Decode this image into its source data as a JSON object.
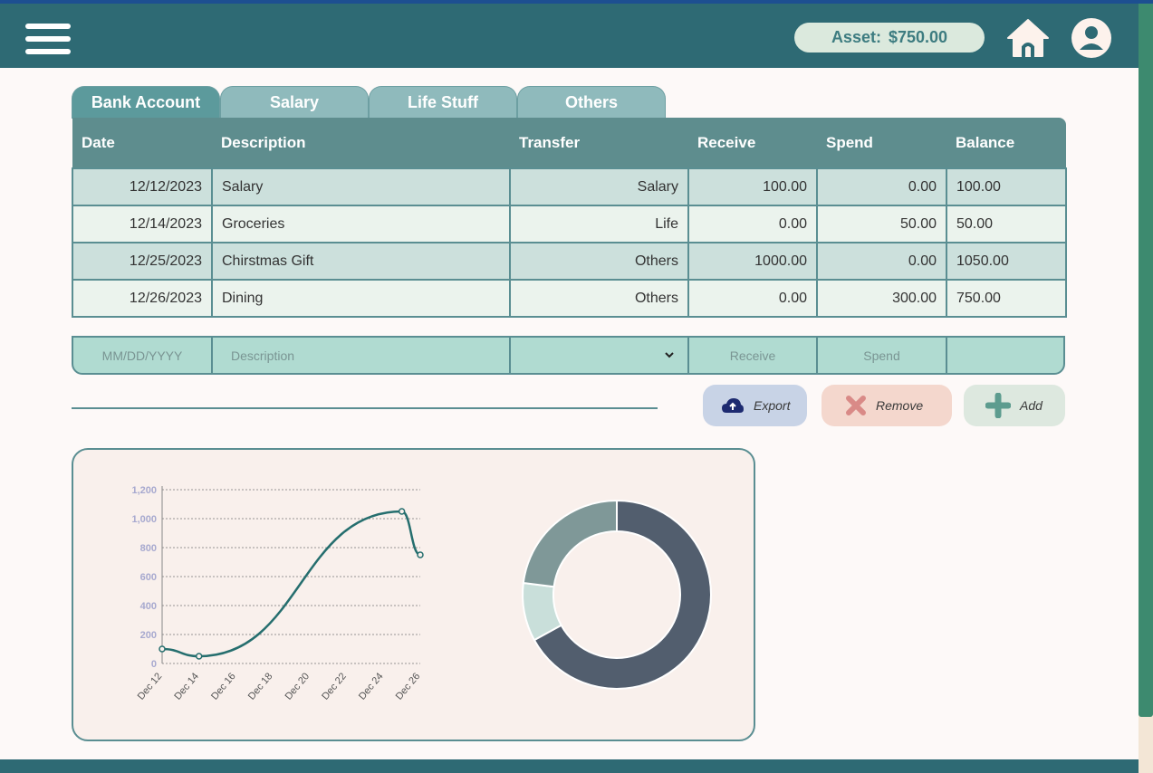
{
  "header": {
    "asset_label": "Asset:",
    "asset_value": "$750.00",
    "menu_icon": "hamburger-menu-icon",
    "home_icon": "home-icon",
    "profile_icon": "user-profile-icon"
  },
  "tabs": [
    {
      "label": "Bank Account",
      "active": true
    },
    {
      "label": "Salary",
      "active": false
    },
    {
      "label": "Life Stuff",
      "active": false
    },
    {
      "label": "Others",
      "active": false
    }
  ],
  "table": {
    "columns": [
      "Date",
      "Description",
      "Transfer",
      "Receive",
      "Spend",
      "Balance"
    ],
    "rows": [
      [
        "12/12/2023",
        "Salary",
        "Salary",
        "100.00",
        "0.00",
        "100.00"
      ],
      [
        "12/14/2023",
        "Groceries",
        "Life",
        "0.00",
        "50.00",
        "50.00"
      ],
      [
        "12/25/2023",
        "Chirstmas Gift",
        "Others",
        "1000.00",
        "0.00",
        "1050.00"
      ],
      [
        "12/26/2023",
        "Dining",
        "Others",
        "0.00",
        "300.00",
        "750.00"
      ]
    ]
  },
  "input_row": {
    "date_placeholder": "MM/DD/YYYY",
    "description_placeholder": "Description",
    "transfer_value": "",
    "receive_placeholder": "Receive",
    "spend_placeholder": "Spend"
  },
  "actions": {
    "export_label": "Export",
    "remove_label": "Remove",
    "add_label": "Add"
  },
  "colors": {
    "header": "#2e6a74",
    "accent": "#5e8d8e",
    "line": "#256e6e"
  },
  "chart_data": [
    {
      "type": "line",
      "x": [
        "Dec 12",
        "Dec 14",
        "Dec 25",
        "Dec 26"
      ],
      "values": [
        100,
        50,
        1050,
        750
      ],
      "x_tick_labels": [
        "Dec 12",
        "Dec 14",
        "Dec 16",
        "Dec 18",
        "Dec 20",
        "Dec 22",
        "Dec 24",
        "Dec 26"
      ],
      "y_tick_labels": [
        "0",
        "200",
        "400",
        "600",
        "800",
        "1,000",
        "1,200"
      ],
      "ylim": [
        0,
        1200
      ],
      "grid": true
    },
    {
      "type": "pie",
      "subtype": "donut",
      "slices": [
        {
          "value": 67,
          "color": "#525e6e"
        },
        {
          "value": 10,
          "color": "#c9dfda"
        },
        {
          "value": 23,
          "color": "#7f9898"
        }
      ]
    }
  ]
}
